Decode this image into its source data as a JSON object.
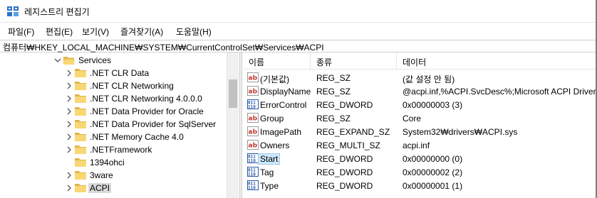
{
  "window": {
    "title": "레지스트리 편집기",
    "app_icon": "registry-editor-icon"
  },
  "menu": [
    {
      "label": "파일(F)"
    },
    {
      "label": "편집(E)"
    },
    {
      "label": "보기(V)"
    },
    {
      "label": "즐겨찾기(A)"
    },
    {
      "label": "도움말(H)"
    }
  ],
  "address": {
    "path": "컴퓨터₩HKEY_LOCAL_MACHINE₩SYSTEM₩CurrentControlSet₩Services₩ACPI"
  },
  "tree": {
    "items": [
      {
        "label": "Services",
        "expander": "chevron-down-icon"
      },
      {
        "label": ".NET CLR Data",
        "expander": "chevron-right-icon"
      },
      {
        "label": ".NET CLR Networking",
        "expander": "chevron-right-icon"
      },
      {
        "label": ".NET CLR Networking 4.0.0.0",
        "expander": "chevron-right-icon"
      },
      {
        "label": ".NET Data Provider for Oracle",
        "expander": "chevron-right-icon"
      },
      {
        "label": ".NET Data Provider for SqlServer",
        "expander": "chevron-right-icon"
      },
      {
        "label": ".NET Memory Cache 4.0",
        "expander": "chevron-right-icon"
      },
      {
        "label": ".NETFramework",
        "expander": "chevron-right-icon"
      },
      {
        "label": "1394ohci",
        "expander": ""
      },
      {
        "label": "3ware",
        "expander": "chevron-right-icon"
      },
      {
        "label": "ACPI",
        "expander": "chevron-right-icon",
        "selected": true
      }
    ]
  },
  "values": {
    "columns": [
      "이름",
      "종류",
      "데이터"
    ],
    "rows": [
      {
        "icon": "string-value-icon",
        "name": "(기본값)",
        "type": "REG_SZ",
        "data": "(값 설정 안 됨)"
      },
      {
        "icon": "string-value-icon",
        "name": "DisplayName",
        "type": "REG_SZ",
        "data": "@acpi.inf,%ACPI.SvcDesc%;Microsoft ACPI Driver"
      },
      {
        "icon": "binary-value-icon",
        "name": "ErrorControl",
        "type": "REG_DWORD",
        "data": "0x00000003 (3)"
      },
      {
        "icon": "string-value-icon",
        "name": "Group",
        "type": "REG_SZ",
        "data": "Core"
      },
      {
        "icon": "string-value-icon",
        "name": "ImagePath",
        "type": "REG_EXPAND_SZ",
        "data": "System32₩drivers₩ACPI.sys"
      },
      {
        "icon": "string-value-icon",
        "name": "Owners",
        "type": "REG_MULTI_SZ",
        "data": "acpi.inf"
      },
      {
        "icon": "binary-value-icon",
        "name": "Start",
        "type": "REG_DWORD",
        "data": "0x00000000 (0)",
        "selected": true
      },
      {
        "icon": "binary-value-icon",
        "name": "Tag",
        "type": "REG_DWORD",
        "data": "0x00000002 (2)"
      },
      {
        "icon": "binary-value-icon",
        "name": "Type",
        "type": "REG_DWORD",
        "data": "0x00000001 (1)"
      }
    ]
  },
  "colors": {
    "folder": "#f8d775",
    "folder_dark": "#e0b64a",
    "selection": "#cce8ff",
    "string_icon_text": "#c0392b",
    "binary_icon": "#2b5aa6"
  }
}
